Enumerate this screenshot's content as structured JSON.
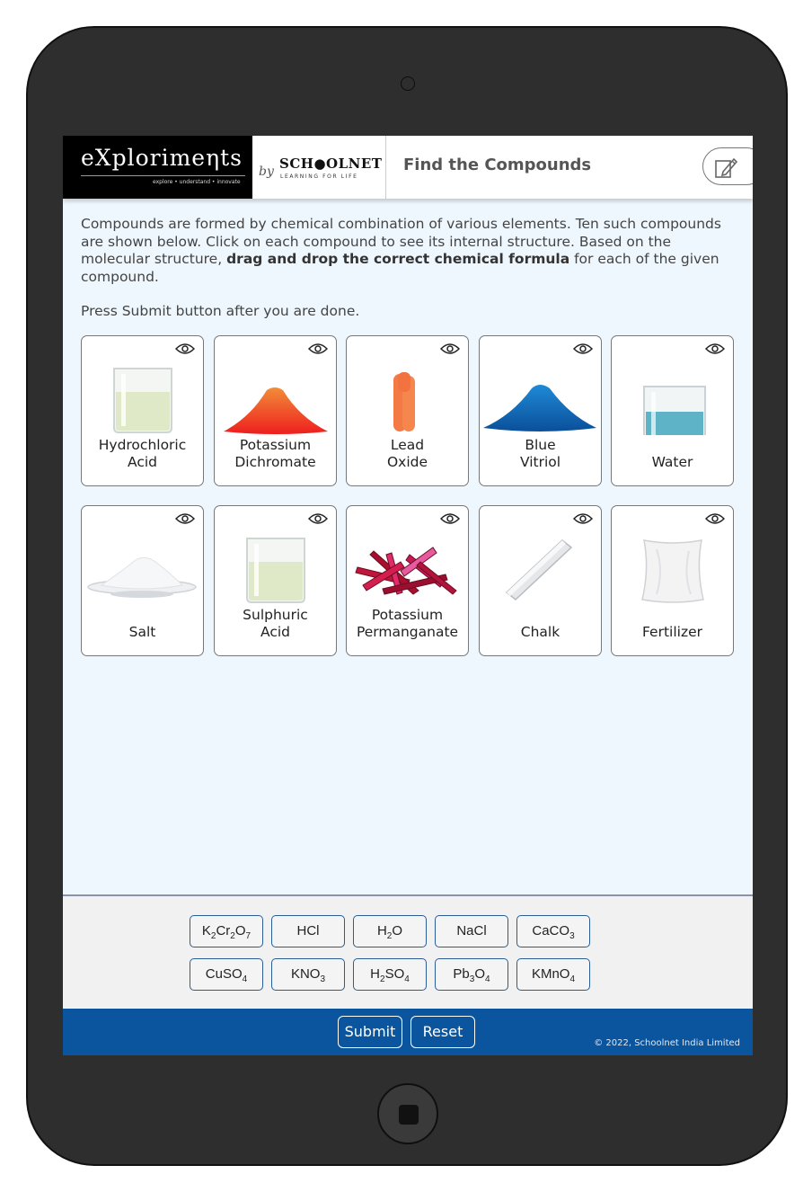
{
  "header": {
    "logo_text": "eXplorimeηts",
    "logo_tagline": "explore • understand • innovate",
    "by": "by",
    "brand": "SCH●OLNET",
    "brand_tagline": "LEARNING FOR LIFE",
    "title": "Find the Compounds"
  },
  "instructions": {
    "part1": "Compounds are formed by chemical combination of various elements. Ten such compounds are shown below. Click on each compound to see its internal structure. Based on the molecular structure, ",
    "bold": "drag and drop the correct chemical formula",
    "part2": " for each of the given compound.",
    "submit_hint": "Press Submit button after you are done."
  },
  "compounds": [
    {
      "line1": "Hydrochloric",
      "line2": "Acid",
      "icon": "beaker-clear-icon"
    },
    {
      "line1": "Potassium",
      "line2": "Dichromate",
      "icon": "orange-powder-icon"
    },
    {
      "line1": "Lead",
      "line2": "Oxide",
      "icon": "lead-oxide-icon"
    },
    {
      "line1": "Blue",
      "line2": "Vitriol",
      "icon": "blue-powder-icon"
    },
    {
      "line1": "",
      "line2": "Water",
      "icon": "beaker-blue-icon"
    },
    {
      "line1": "",
      "line2": "Salt",
      "icon": "salt-plate-icon"
    },
    {
      "line1": "Sulphuric",
      "line2": "Acid",
      "icon": "beaker-clear-icon"
    },
    {
      "line1": "Potassium",
      "line2": "Permanganate",
      "icon": "crystals-icon"
    },
    {
      "line1": "",
      "line2": "Chalk",
      "icon": "chalk-icon"
    },
    {
      "line1": "",
      "line2": "Fertilizer",
      "icon": "sack-icon"
    }
  ],
  "formulas": [
    [
      {
        "t": "K"
      },
      {
        "s": "2"
      },
      {
        "t": "Cr"
      },
      {
        "s": "2"
      },
      {
        "t": "O"
      },
      {
        "s": "7"
      }
    ],
    [
      {
        "t": "HCl"
      }
    ],
    [
      {
        "t": "H"
      },
      {
        "s": "2"
      },
      {
        "t": "O"
      }
    ],
    [
      {
        "t": "NaCl"
      }
    ],
    [
      {
        "t": "CaCO"
      },
      {
        "s": "3"
      }
    ],
    [
      {
        "t": "CuSO"
      },
      {
        "s": "4"
      }
    ],
    [
      {
        "t": "KNO"
      },
      {
        "s": "3"
      }
    ],
    [
      {
        "t": "H"
      },
      {
        "s": "2"
      },
      {
        "t": "SO"
      },
      {
        "s": "4"
      }
    ],
    [
      {
        "t": "Pb"
      },
      {
        "s": "3"
      },
      {
        "t": "O"
      },
      {
        "s": "4"
      }
    ],
    [
      {
        "t": "KMnO"
      },
      {
        "s": "4"
      }
    ]
  ],
  "footer": {
    "submit": "Submit",
    "reset": "Reset",
    "copyright": "© 2022, Schoolnet India Limited"
  }
}
